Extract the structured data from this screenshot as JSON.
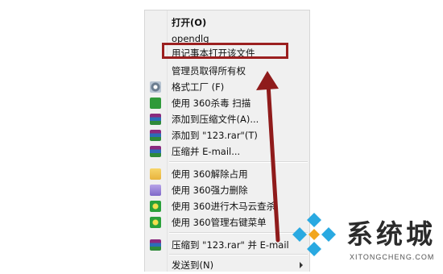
{
  "menu": {
    "items": [
      {
        "label": "打开(O)",
        "icon": "",
        "bold": true
      },
      {
        "label": "opendlg",
        "icon": ""
      },
      {
        "label": "用记事本打开该文件",
        "icon": ""
      },
      {
        "label": "管理员取得所有权",
        "icon": ""
      },
      {
        "label": "格式工厂 (F)",
        "icon": "format-factory-icon"
      },
      {
        "label": "使用 360杀毒 扫描",
        "icon": "360-antivirus-shield-icon"
      },
      {
        "label": "添加到压缩文件(A)...",
        "icon": "winrar-icon"
      },
      {
        "label": "添加到 \"123.rar\"(T)",
        "icon": "winrar-icon"
      },
      {
        "label": "压缩并 E-mail...",
        "icon": "winrar-icon"
      },
      {
        "label": "使用 360解除占用",
        "icon": "360-unlock-folder-icon"
      },
      {
        "label": "使用 360强力删除",
        "icon": "360-force-delete-icon"
      },
      {
        "label": "使用 360进行木马云查杀",
        "icon": "360-trojan-scan-icon"
      },
      {
        "label": "使用 360管理右键菜单",
        "icon": "360-menu-manager-icon"
      },
      {
        "label": "压缩到 \"123.rar\" 并 E-mail",
        "icon": "winrar-icon"
      },
      {
        "label": "发送到(N)",
        "icon": "",
        "submenu": true
      }
    ]
  },
  "annotation": {
    "color": "#9b1f1f"
  },
  "watermark": {
    "cn": "系统城",
    "en": "XITONGCHENG.COM"
  }
}
